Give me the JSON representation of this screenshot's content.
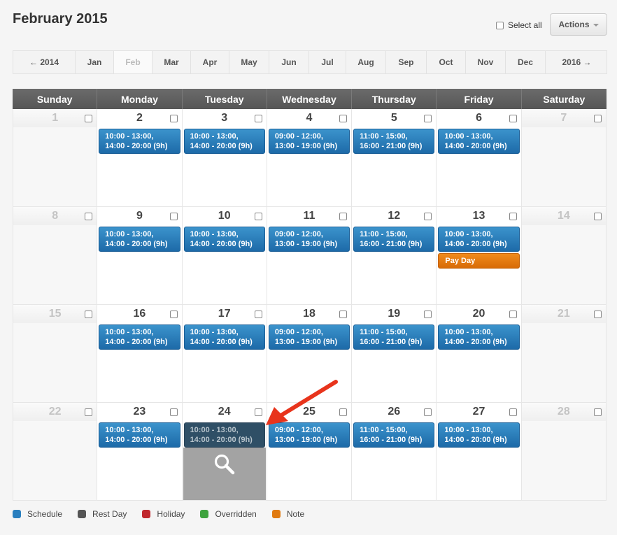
{
  "page": {
    "title": "February 2015"
  },
  "toolbar": {
    "select_all_label": "Select all",
    "actions_label": "Actions"
  },
  "month_nav": {
    "items": [
      "← 2014",
      "Jan",
      "Feb",
      "Mar",
      "Apr",
      "May",
      "Jun",
      "Jul",
      "Aug",
      "Sep",
      "Oct",
      "Nov",
      "Dec",
      "2016 →"
    ],
    "active": "Feb"
  },
  "calendar": {
    "headers": [
      "Sunday",
      "Monday",
      "Tuesday",
      "Wednesday",
      "Thursday",
      "Friday",
      "Saturday"
    ],
    "schedules": {
      "mon": [
        "10:00 - 13:00,",
        "14:00 - 20:00 (9h)"
      ],
      "tue": [
        "10:00 - 13:00,",
        "14:00 - 20:00 (9h)"
      ],
      "wed": [
        "09:00 - 12:00,",
        "13:00 - 19:00 (9h)"
      ],
      "thu": [
        "11:00 - 15:00,",
        "16:00 - 21:00 (9h)"
      ],
      "fri": [
        "10:00 - 13:00,",
        "14:00 - 20:00 (9h)"
      ]
    },
    "weeks": [
      {
        "days": [
          "1",
          "2",
          "3",
          "4",
          "5",
          "6",
          "7"
        ]
      },
      {
        "days": [
          "8",
          "9",
          "10",
          "11",
          "12",
          "13",
          "14"
        ],
        "note": {
          "day_index": 5,
          "label": "Pay Day"
        }
      },
      {
        "days": [
          "15",
          "16",
          "17",
          "18",
          "19",
          "20",
          "21"
        ]
      },
      {
        "days": [
          "22",
          "23",
          "24",
          "25",
          "26",
          "27",
          "28"
        ],
        "hovered_day_index": 2
      }
    ]
  },
  "legend": [
    {
      "label": "Schedule",
      "color": "#2a7fbf"
    },
    {
      "label": "Rest Day",
      "color": "#555555"
    },
    {
      "label": "Holiday",
      "color": "#c0272d"
    },
    {
      "label": "Overridden",
      "color": "#3ea33e"
    },
    {
      "label": "Note",
      "color": "#e07a10"
    }
  ],
  "icons": {
    "hover_zoom": "magnifier-icon",
    "annotation": "red-arrow-icon"
  },
  "colors": {
    "schedule": "#2a7fbf",
    "note": "#e07a10",
    "header": "#5f5f5f",
    "arrow": "#e8341c"
  }
}
